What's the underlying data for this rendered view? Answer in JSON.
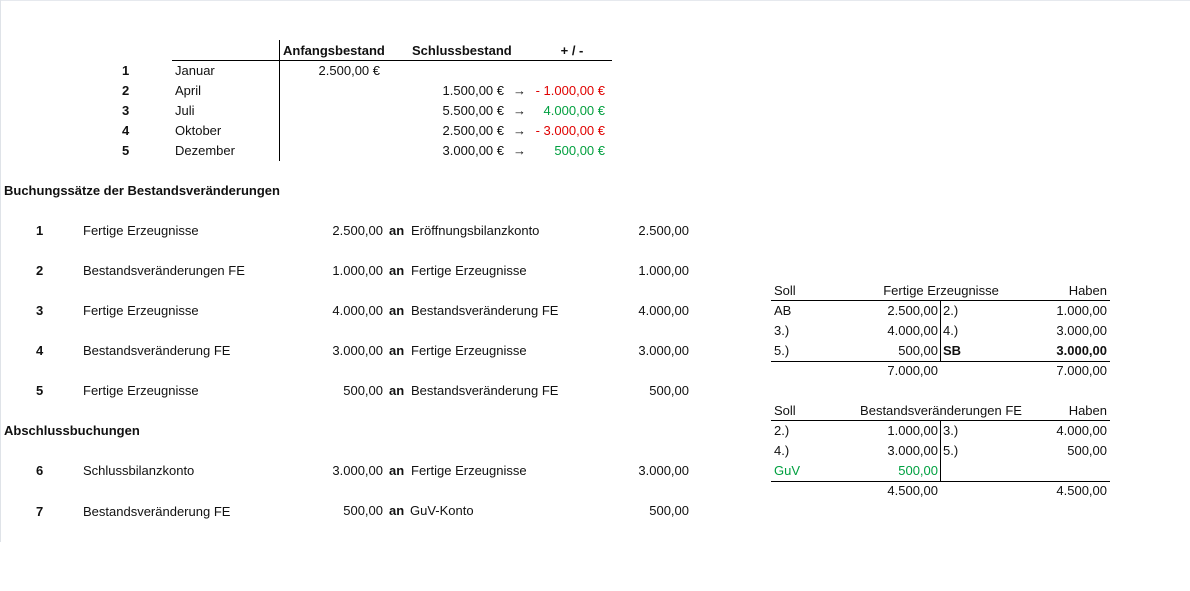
{
  "overview": {
    "headers": {
      "anfang": "Anfangsbestand",
      "schluss": "Schlussbestand",
      "diff": "+ / -"
    },
    "rows": [
      {
        "nr": "1",
        "month": "Januar",
        "anfang": "2.500,00 €",
        "schluss": "",
        "arrow": "",
        "diff": ""
      },
      {
        "nr": "2",
        "month": "April",
        "anfang": "",
        "schluss": "1.500,00 €",
        "arrow": "→",
        "diff": "- 1.000,00 €"
      },
      {
        "nr": "3",
        "month": "Juli",
        "anfang": "",
        "schluss": "5.500,00 €",
        "arrow": "→",
        "diff": "4.000,00 €"
      },
      {
        "nr": "4",
        "month": "Oktober",
        "anfang": "",
        "schluss": "2.500,00 €",
        "arrow": "→",
        "diff": "- 3.000,00 €"
      },
      {
        "nr": "5",
        "month": "Dezember",
        "anfang": "",
        "schluss": "3.000,00 €",
        "arrow": "→",
        "diff": "500,00 €"
      }
    ]
  },
  "buchungen": {
    "title": "Buchungssätze der Bestandsveränderungen",
    "an": "an",
    "rows": [
      {
        "nr": "1",
        "soll": "Fertige Erzeugnisse",
        "amount1": "2.500,00",
        "haben": "Eröffnungsbilanzkonto",
        "amount2": "2.500,00"
      },
      {
        "nr": "2",
        "soll": "Bestandsveränderungen FE",
        "amount1": "1.000,00",
        "haben": "Fertige Erzeugnisse",
        "amount2": "1.000,00"
      },
      {
        "nr": "3",
        "soll": "Fertige Erzeugnisse",
        "amount1": "4.000,00",
        "haben": "Bestandsveränderung FE",
        "amount2": "4.000,00"
      },
      {
        "nr": "4",
        "soll": "Bestandsveränderung FE",
        "amount1": "3.000,00",
        "haben": "Fertige Erzeugnisse",
        "amount2": "3.000,00"
      },
      {
        "nr": "5",
        "soll": "Fertige Erzeugnisse",
        "amount1": "500,00",
        "haben": "Bestandsveränderung FE",
        "amount2": "500,00"
      }
    ]
  },
  "abschluss": {
    "title": "Abschlussbuchungen",
    "rows": [
      {
        "nr": "6",
        "soll": "Schlussbilanzkonto",
        "amount1": "3.000,00",
        "haben": "Fertige Erzeugnisse",
        "amount2": "3.000,00"
      },
      {
        "nr": "7",
        "soll": "Bestandsveränderung FE",
        "amount1": "500,00",
        "haben": "GuV-Konto",
        "amount2": "500,00"
      }
    ]
  },
  "konto_fe": {
    "soll_label": "Soll",
    "title": "Fertige Erzeugnisse",
    "haben_label": "Haben",
    "rows": [
      {
        "sl": "AB",
        "sa": "2.500,00",
        "hl": "2.)",
        "ha": "1.000,00"
      },
      {
        "sl": "3.)",
        "sa": "4.000,00",
        "hl": "4.)",
        "ha": "3.000,00"
      },
      {
        "sl": "5.)",
        "sa": "500,00",
        "hl": "SB",
        "ha": "3.000,00"
      }
    ],
    "total_soll": "7.000,00",
    "total_haben": "7.000,00"
  },
  "konto_bv": {
    "soll_label": "Soll",
    "title": "Bestandsveränderungen FE",
    "haben_label": "Haben",
    "rows": [
      {
        "sl": "2.)",
        "sa": "1.000,00",
        "hl": "3.)",
        "ha": "4.000,00"
      },
      {
        "sl": "4.)",
        "sa": "3.000,00",
        "hl": "5.)",
        "ha": "500,00"
      },
      {
        "sl": "GuV",
        "sa": "500,00",
        "hl": "",
        "ha": ""
      }
    ],
    "total_soll": "4.500,00",
    "total_haben": "4.500,00"
  },
  "colors": {
    "negative": "#e00000",
    "positive": "#00a040"
  }
}
